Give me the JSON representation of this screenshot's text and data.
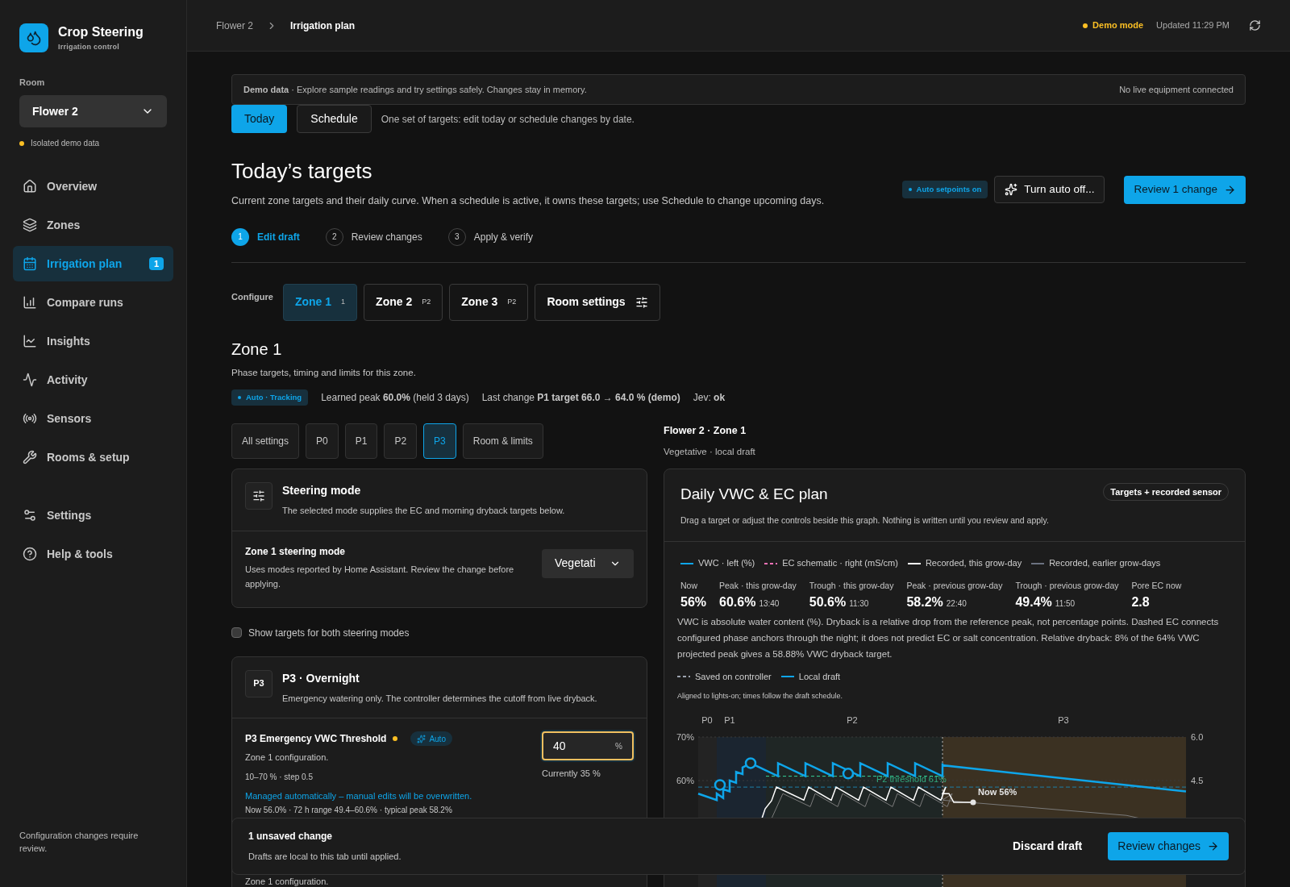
{
  "app": {
    "name": "Crop Steering",
    "subtitle": "Irrigation control"
  },
  "room": {
    "label": "Room",
    "value": "Flower 2",
    "note": "Isolated demo data"
  },
  "nav": [
    {
      "label": "Overview",
      "selected": false
    },
    {
      "label": "Zones",
      "selected": false
    },
    {
      "label": "Irrigation plan",
      "selected": true,
      "badge": "1"
    },
    {
      "label": "Compare runs",
      "selected": false
    },
    {
      "label": "Insights",
      "selected": false
    },
    {
      "label": "Activity",
      "selected": false
    },
    {
      "label": "Sensors",
      "selected": false
    },
    {
      "label": "Rooms & setup",
      "selected": false
    }
  ],
  "nav_secondary": [
    {
      "label": "Settings",
      "selected": false
    },
    {
      "label": "Help & tools",
      "selected": false
    }
  ],
  "sidebar_footer": "Configuration changes require review.",
  "breadcrumb": [
    "Flower 2",
    "Irrigation plan"
  ],
  "header": {
    "mode": "Demo mode",
    "updated": "Updated 11:29 PM"
  },
  "banner": {
    "title": "Demo data",
    "text": " · Explore sample readings and try settings safely. Changes stay in memory.",
    "right": "No live equipment connected"
  },
  "view_tabs": [
    {
      "label": "Today",
      "selected": true
    },
    {
      "label": "Schedule",
      "selected": false
    }
  ],
  "view_note": "One set of targets: edit today or schedule changes by date.",
  "page": {
    "title": "Today’s targets",
    "subtitle": "Current zone targets and their daily curve. When a schedule is active, it owns these targets; use Schedule to change upcoming days.",
    "auto_badge": "Auto setpoints on",
    "auto_button": "Turn auto off...",
    "review_button": "Review 1 change"
  },
  "steps": [
    {
      "number": "1",
      "label": "Edit draft",
      "selected": true
    },
    {
      "number": "2",
      "label": "Review changes",
      "selected": false
    },
    {
      "number": "3",
      "label": "Apply & verify",
      "selected": false
    }
  ],
  "configure": {
    "label": "Configure",
    "tabs": [
      {
        "kind": "zone",
        "label": "Zone 1",
        "tag": "1",
        "selected": true
      },
      {
        "kind": "zone",
        "label": "Zone 2",
        "tag": "P2",
        "selected": false
      },
      {
        "kind": "zone",
        "label": "Zone 3",
        "tag": "P2",
        "selected": false
      },
      {
        "kind": "settings",
        "label": "Room settings",
        "selected": false
      }
    ]
  },
  "zone": {
    "title": "Zone 1",
    "subtitle": "Phase targets, timing and limits for this zone.",
    "badge": "Auto · Tracking",
    "learned": "Learned peak **60.0%** (held 3 days)",
    "last_change": "Last change **P1 target 66.0 → 64.0 % (demo)**",
    "jev": "Jev: **ok**"
  },
  "phase_tabs": [
    {
      "label": "All settings",
      "selected": false
    },
    {
      "label": "P0",
      "selected": false
    },
    {
      "label": "P1",
      "selected": false
    },
    {
      "label": "P2",
      "selected": false
    },
    {
      "label": "P3",
      "selected": true
    },
    {
      "label": "Room & limits",
      "selected": false
    }
  ],
  "steering": {
    "title": "Steering mode",
    "description": "The selected mode supplies the EC and morning dryback targets below.",
    "field_label": "Zone 1 steering mode",
    "field_help": "Uses modes reported by Home Assistant. Review the change before applying.",
    "select_value": "Vegetati"
  },
  "both_modes": {
    "label": "Show targets for both steering modes",
    "checked": false
  },
  "phase_card": {
    "badge": "P3",
    "title": "P3 · Overnight",
    "description": "Emergency watering only. The controller determines the cutoff from live dryback.",
    "setting": {
      "label": "P3 Emergency VWC Threshold",
      "modified": true,
      "auto_tag": "Auto",
      "help": "Zone 1 configuration.",
      "range": "10–70 % · step 0.5",
      "note": "Managed automatically – manual edits will be overwritten.",
      "stats": "Now 56.0% · 72 h range 49.4–60.6% · typical peak 58.2%",
      "value": "40",
      "unit": "%",
      "current": "Currently 35 %"
    },
    "next_help": "Zone 1 configuration."
  },
  "preview": {
    "title": "Flower 2 · Zone 1",
    "subtitle": "Vegetative · local draft"
  },
  "chart_card": {
    "title": "Daily VWC & EC plan",
    "subtitle": "Drag a target or adjust the controls beside this graph. Nothing is written until you review and apply.",
    "badge": "Targets + recorded sensor",
    "legend": [
      {
        "kind": "solid",
        "label": "VWC · left (%)",
        "color": "#0ea5e9"
      },
      {
        "kind": "dashed",
        "label": "EC schematic · right (mS/cm)",
        "color": "#f472b6"
      },
      {
        "kind": "solid",
        "label": "Recorded, this grow-day",
        "color": "#ffffff"
      },
      {
        "kind": "solid",
        "label": "Recorded, earlier grow-days",
        "color": "#6b7280"
      }
    ],
    "stats": [
      {
        "label": "Now",
        "value": "56%"
      },
      {
        "label": "Peak · this grow-day",
        "value": "60.6%",
        "time": "13:40"
      },
      {
        "label": "Trough · this grow-day",
        "value": "50.6%",
        "time": "11:30"
      },
      {
        "label": "Peak · previous grow-day",
        "value": "58.2%",
        "time": "22:40"
      },
      {
        "label": "Trough · previous grow-day",
        "value": "49.4%",
        "time": "11:50"
      },
      {
        "label": "Pore EC now",
        "value": "2.8"
      }
    ],
    "explanation": "VWC is absolute water content (%). Dryback is a relative drop from the reference peak, not percentage points. Dashed EC connects configured phase anchors through the night; it does not predict EC or salt concentration. Relative dryback: 8% of the 64% VWC projected peak gives a 58.88% VWC dryback target.",
    "legend2": [
      {
        "kind": "dashed",
        "label": "Saved on controller",
        "color": "#9ca3af"
      },
      {
        "kind": "solid",
        "label": "Local draft",
        "color": "#0ea5e9"
      }
    ],
    "aligned_note": "Aligned to lights-on; times follow the draft schedule.",
    "phases": [
      "P0",
      "P1",
      "P2",
      "P3"
    ],
    "left_ticks": [
      "70%",
      "60%"
    ],
    "right_ticks": [
      "6.0",
      "4.5"
    ],
    "threshold_label": "P2 threshold 61%",
    "now_label": "Now 56%"
  },
  "unsaved": {
    "title": "1 unsaved change",
    "text": "Drafts are local to this tab until applied.",
    "discard": "Discard draft",
    "review": "Review changes"
  }
}
